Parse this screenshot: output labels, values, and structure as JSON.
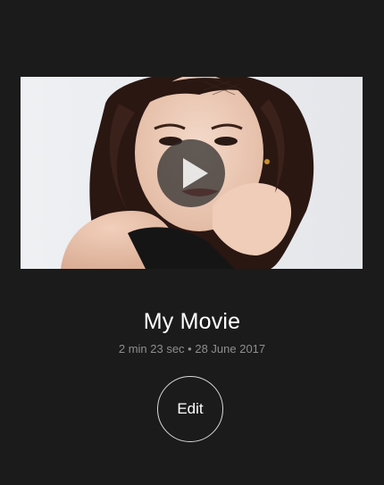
{
  "movie": {
    "title": "My Movie",
    "duration": "2 min 23 sec",
    "separator": "•",
    "date": "28 June 2017",
    "meta_line": "2 min 23 sec • 28 June 2017"
  },
  "actions": {
    "edit_label": "Edit",
    "play_icon": "play-icon"
  },
  "colors": {
    "background": "#1b1b1b",
    "title_text": "#ffffff",
    "meta_text": "#8e8e8e",
    "edit_border": "#d8d8d8",
    "play_overlay": "#282828"
  }
}
